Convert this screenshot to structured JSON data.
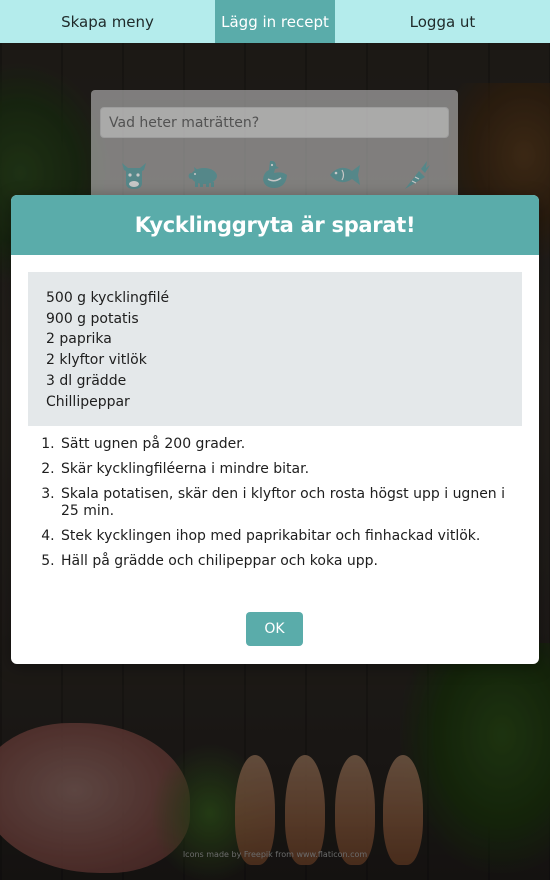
{
  "nav": {
    "items": [
      {
        "label": "Skapa meny",
        "active": false
      },
      {
        "label": "Lägg in recept",
        "active": true
      },
      {
        "label": "Logga ut",
        "active": false
      }
    ]
  },
  "form": {
    "name_placeholder": "Vad heter maträtten?",
    "categories": [
      {
        "icon": "cow-icon"
      },
      {
        "icon": "pig-icon"
      },
      {
        "icon": "chicken-icon"
      },
      {
        "icon": "fish-icon"
      },
      {
        "icon": "carrot-icon"
      }
    ]
  },
  "modal": {
    "title": "Kycklinggryta är sparat!",
    "ingredients": [
      "500 g kycklingfilé",
      "900 g potatis",
      "2 paprika",
      "2 klyftor vitlök",
      "3 dl grädde",
      "Chillipeppar"
    ],
    "steps": [
      "Sätt ugnen på 200 grader.",
      "Skär kycklingfiléerna i mindre bitar.",
      "Skala potatisen, skär den i klyftor och rosta högst upp i ugnen i 25 min.",
      "Stek kycklingen ihop med paprikabitar och finhackad vitlök.",
      "Häll på grädde och chilipeppar och koka upp."
    ],
    "ok_label": "OK"
  },
  "footer": {
    "credit": "Icons made by Freepik from www.flaticon.com"
  },
  "colors": {
    "accent": "#5aacaa",
    "nav_bg": "#b4ecec",
    "ingredients_bg": "#e4e8ea"
  }
}
